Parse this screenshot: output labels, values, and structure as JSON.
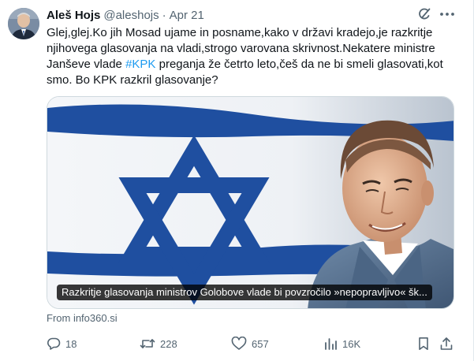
{
  "author": {
    "name": "Aleš Hojs",
    "handle": "@aleshojs",
    "separator": "·",
    "date": "Apr 21"
  },
  "tweet": {
    "text_before": "Glej,glej.Ko jih Mosad ujame in posname,kako v državi kradejo,je razkritje njihovega glasovanja na vladi,strogo varovana skrivnost.Nekatere ministre Janševe vlade ",
    "hashtag": "#KPK",
    "text_after": " preganja že četrto leto,češ da ne bi smeli glasovati,kot smo. Bo KPK razkril glasovanje?"
  },
  "card": {
    "caption": "Razkritje glasovanja ministrov Golobove vlade bi povzročilo »nepopravljivo« šk...",
    "source": "From info360.si"
  },
  "actions": {
    "replies": "18",
    "retweets": "228",
    "likes": "657",
    "views": "16K"
  },
  "icons": {
    "header": [
      "grok-icon",
      "more-icon"
    ],
    "actions": [
      "reply-icon",
      "retweet-icon",
      "like-icon",
      "views-icon",
      "bookmark-icon",
      "share-icon"
    ]
  },
  "colors": {
    "text": "#0f1419",
    "secondary": "#536471",
    "link": "#1d9bf0",
    "flag_blue": "#1f4fa0"
  }
}
